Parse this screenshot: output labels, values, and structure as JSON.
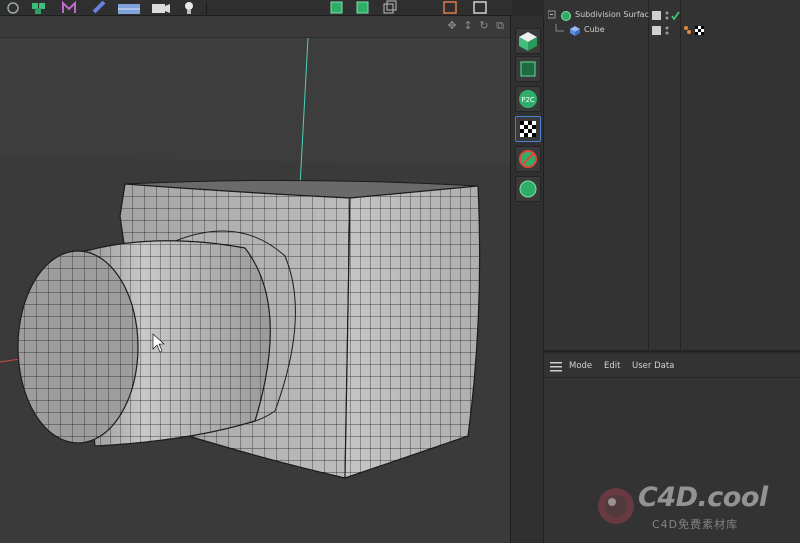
{
  "object_manager": {
    "objects": [
      {
        "name": "Subdivision Surfac",
        "icon": "subdivision-surface-icon"
      },
      {
        "name": "Cube",
        "icon": "cube-icon"
      }
    ]
  },
  "attribute_manager": {
    "menu": [
      "Mode",
      "Edit",
      "User Data"
    ]
  },
  "watermark": {
    "logo": "C4D.cool",
    "subtitle": "C4D免费素材库"
  },
  "colors": {
    "accent_green": "#2fae6a",
    "axis_y": "#4fd1b8",
    "axis_x": "#c94a3a",
    "wire": "#1c1c1c",
    "mesh": "#b3b3b3"
  }
}
